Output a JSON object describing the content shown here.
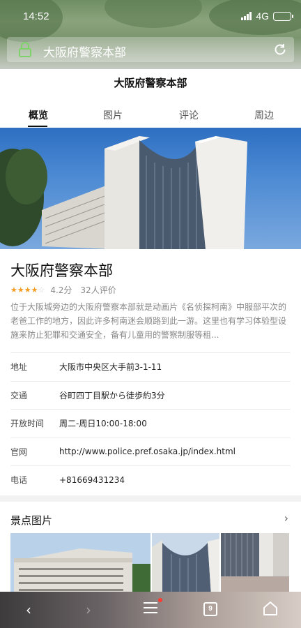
{
  "status": {
    "time": "14:52",
    "network": "4G"
  },
  "browser": {
    "url_text": "大阪府警察本部"
  },
  "page": {
    "title": "大阪府警察本部"
  },
  "tabs": [
    {
      "label": "概览",
      "active": true
    },
    {
      "label": "图片",
      "active": false
    },
    {
      "label": "评论",
      "active": false
    },
    {
      "label": "周边",
      "active": false
    }
  ],
  "place": {
    "name": "大阪府警察本部",
    "stars": 4,
    "score": "4.2分",
    "reviews": "32人评价",
    "description": "位于大阪城旁边的大阪府警察本部就是动画片《名侦探柯南》中服部平次的老爸工作的地方，因此许多柯南迷会顺路到此一游。这里也有学习体验型设施来防止犯罪和交通安全，备有儿童用的警察制服等租..."
  },
  "info": [
    {
      "key": "地址",
      "value": "大阪市中央区大手前3-1-11"
    },
    {
      "key": "交通",
      "value": "谷町四丁目駅から徒歩約3分"
    },
    {
      "key": "开放时间",
      "value": "周二-周日10:00-18:00"
    },
    {
      "key": "官网",
      "value": "http://www.police.pref.osaka.jp/index.html"
    },
    {
      "key": "电话",
      "value": "+81669431234"
    }
  ],
  "gallery": {
    "title": "景点图片",
    "more": "›"
  },
  "bottom_nav": {
    "back": "‹",
    "forward": "›",
    "tab_count": "9"
  },
  "colors": {
    "star": "#f39c1f",
    "lock": "#7dd36a",
    "notify": "#ff3b30"
  }
}
